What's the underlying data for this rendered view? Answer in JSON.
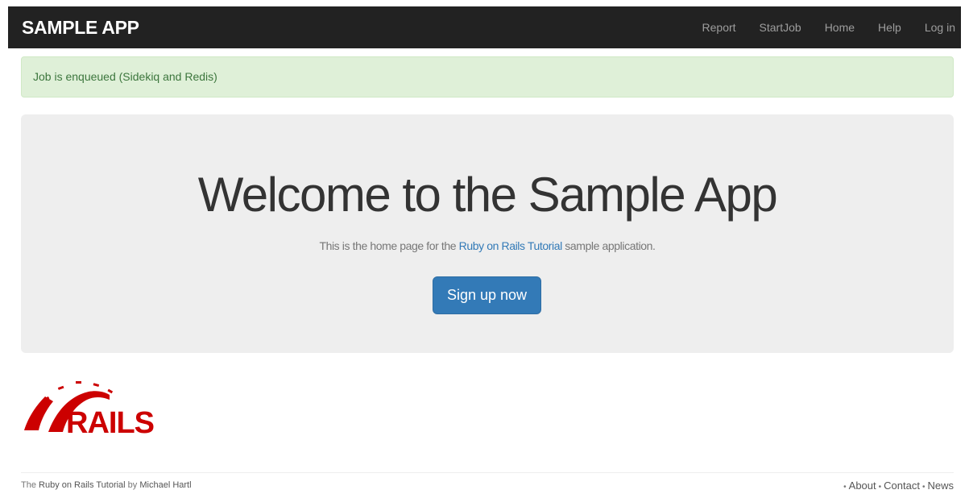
{
  "navbar": {
    "brand": "SAMPLE APP",
    "links": [
      "Report",
      "StartJob",
      "Home",
      "Help",
      "Log in"
    ]
  },
  "alert": {
    "message": "Job is enqueued (Sidekiq and Redis)",
    "color": "#3c763d",
    "background": "#dff0d8"
  },
  "hero": {
    "title": "Welcome to the Sample App",
    "lead_prefix": "This is the home page for the ",
    "lead_link": "Ruby on Rails Tutorial",
    "lead_suffix": " sample application.",
    "signup_button": "Sign up now",
    "button_color": "#337ab7"
  },
  "logo": {
    "text": "RAILS",
    "color": "#cc0000",
    "icon": "rails-logo-icon"
  },
  "footer": {
    "left_prefix": "The ",
    "left_link1": "Ruby on Rails Tutorial",
    "left_middle": " by ",
    "left_link2": "Michael Hartl",
    "right_links": [
      "About",
      "Contact",
      "News"
    ],
    "bullet": "•"
  }
}
